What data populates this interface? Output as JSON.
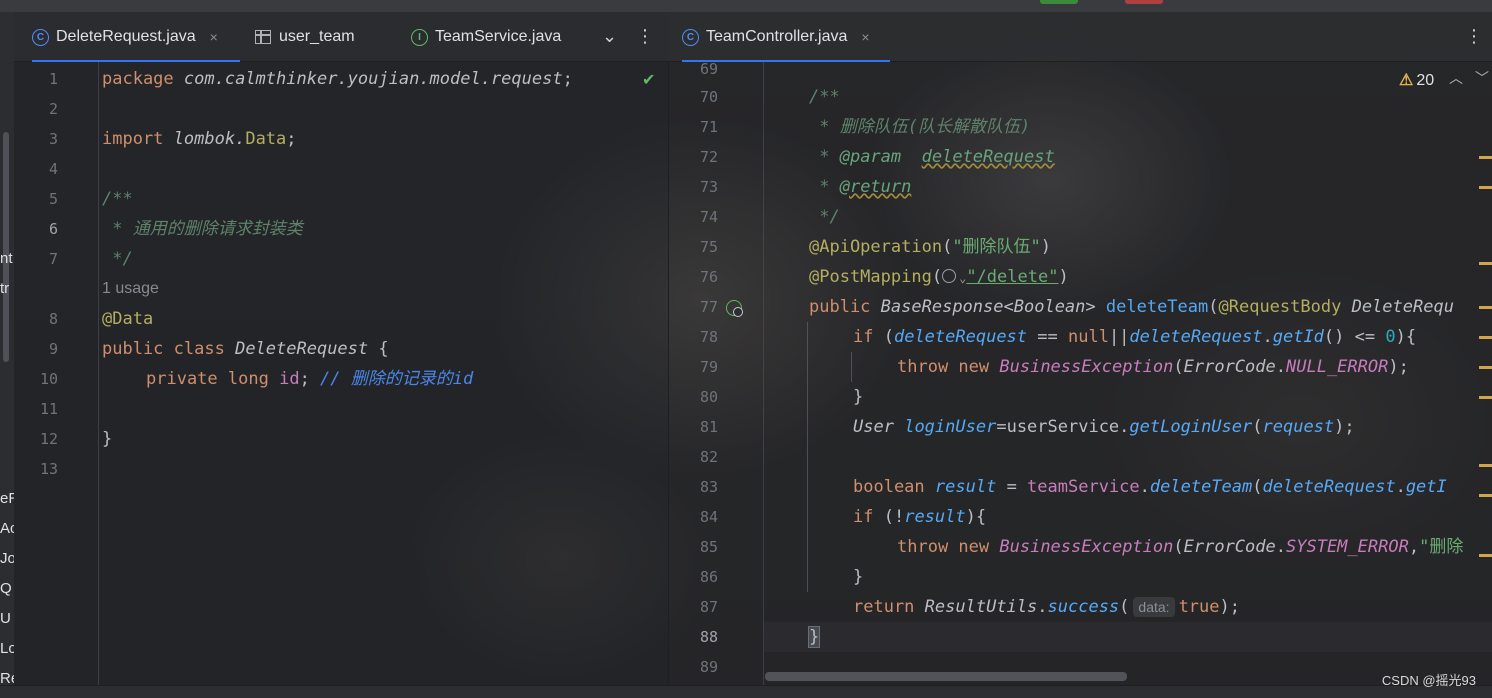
{
  "tabs_left": [
    {
      "label": "DeleteRequest.java",
      "icon": "class-icon",
      "active": true,
      "close": "×"
    },
    {
      "label": "user_team",
      "icon": "table-icon",
      "active": false
    },
    {
      "label": "TeamService.java",
      "icon": "interface-icon",
      "active": false
    }
  ],
  "tabs_right": [
    {
      "label": "TeamController.java",
      "icon": "class-icon",
      "active": true,
      "close": "×"
    }
  ],
  "left_fragments": [
    "nt",
    "tr",
    "eR",
    "Ac",
    "Jo",
    "Q",
    "U",
    "Lo",
    "Re"
  ],
  "left_editor": {
    "line_numbers": [
      "1",
      "2",
      "3",
      "4",
      "5",
      "6",
      "7",
      "8",
      "9",
      "10",
      "11",
      "12",
      "13"
    ],
    "current_line": "6",
    "usage_hint": "1 usage",
    "lines": {
      "l1_kw": "package",
      "l1_rest": "com.calmthinker.youjian.model.request",
      "l3_kw": "import",
      "l3_pkg": "lombok.",
      "l3_cls": "Data",
      "l5": "/**",
      "l6": " * 通用的删除请求封装类",
      "l7": " */",
      "l8": "@Data",
      "l9_kw": "public class",
      "l9_cls": "DeleteRequest",
      "l10_kw": "private long",
      "l10_field": "id",
      "l10_comment": "// 删除的记录的id",
      "l12": "}"
    }
  },
  "right_editor": {
    "warnings_count": "20",
    "line_numbers": [
      "69",
      "70",
      "71",
      "72",
      "73",
      "74",
      "75",
      "76",
      "77",
      "78",
      "79",
      "80",
      "81",
      "82",
      "83",
      "84",
      "85",
      "86",
      "87",
      "88",
      "89"
    ],
    "current_line": "88",
    "lines": {
      "l70": "/**",
      "l71": " * 删除队伍(队长解散队伍)",
      "l72_star": " * ",
      "l72_tag": "@param",
      "l72_name": "deleteRequest",
      "l73_star": " * ",
      "l73_tag": "@return",
      "l74": " */",
      "l75_ann": "@ApiOperation",
      "l75_str": "\"删除队伍\"",
      "l76_ann": "@PostMapping",
      "l76_str": "\"/delete\"",
      "l77_kw": "public",
      "l77_type": "BaseResponse",
      "l77_gen": "Boolean",
      "l77_fn": "deleteTeam",
      "l77_ann": "@RequestBody",
      "l77_param": "DeleteRequ",
      "l78_kw": "if",
      "l78_a": "deleteRequest",
      "l78_null": "null",
      "l78_b": "deleteRequest",
      "l78_m": "getId",
      "l78_num": "0",
      "l79_kw": "throw new",
      "l79_exc": "BusinessException",
      "l79_cls": "ErrorCode",
      "l79_field": "NULL_ERROR",
      "l80": "}",
      "l81_type": "User",
      "l81_var": "loginUser",
      "l81_svc": "userService",
      "l81_m": "getLoginUser",
      "l81_arg": "request",
      "l83_kw": "boolean",
      "l83_var": "result",
      "l83_svc": "teamService",
      "l83_m": "deleteTeam",
      "l83_arg": "deleteRequest",
      "l83_m2": "getI",
      "l84_kw": "if",
      "l84_var": "result",
      "l85_kw": "throw new",
      "l85_exc": "BusinessException",
      "l85_cls": "ErrorCode",
      "l85_field": "SYSTEM_ERROR",
      "l85_str": "\"删除",
      "l86": "}",
      "l87_kw": "return",
      "l87_cls": "ResultUtils",
      "l87_m": "success",
      "l87_hint": "data:",
      "l87_val": "true",
      "l88": "}"
    }
  },
  "watermark": "CSDN @摇光93",
  "colors": {
    "accent": "#3574f0",
    "keyword": "#cf8e6d",
    "string": "#6aab73",
    "function": "#56a8f5",
    "annotation": "#b3ae60"
  }
}
